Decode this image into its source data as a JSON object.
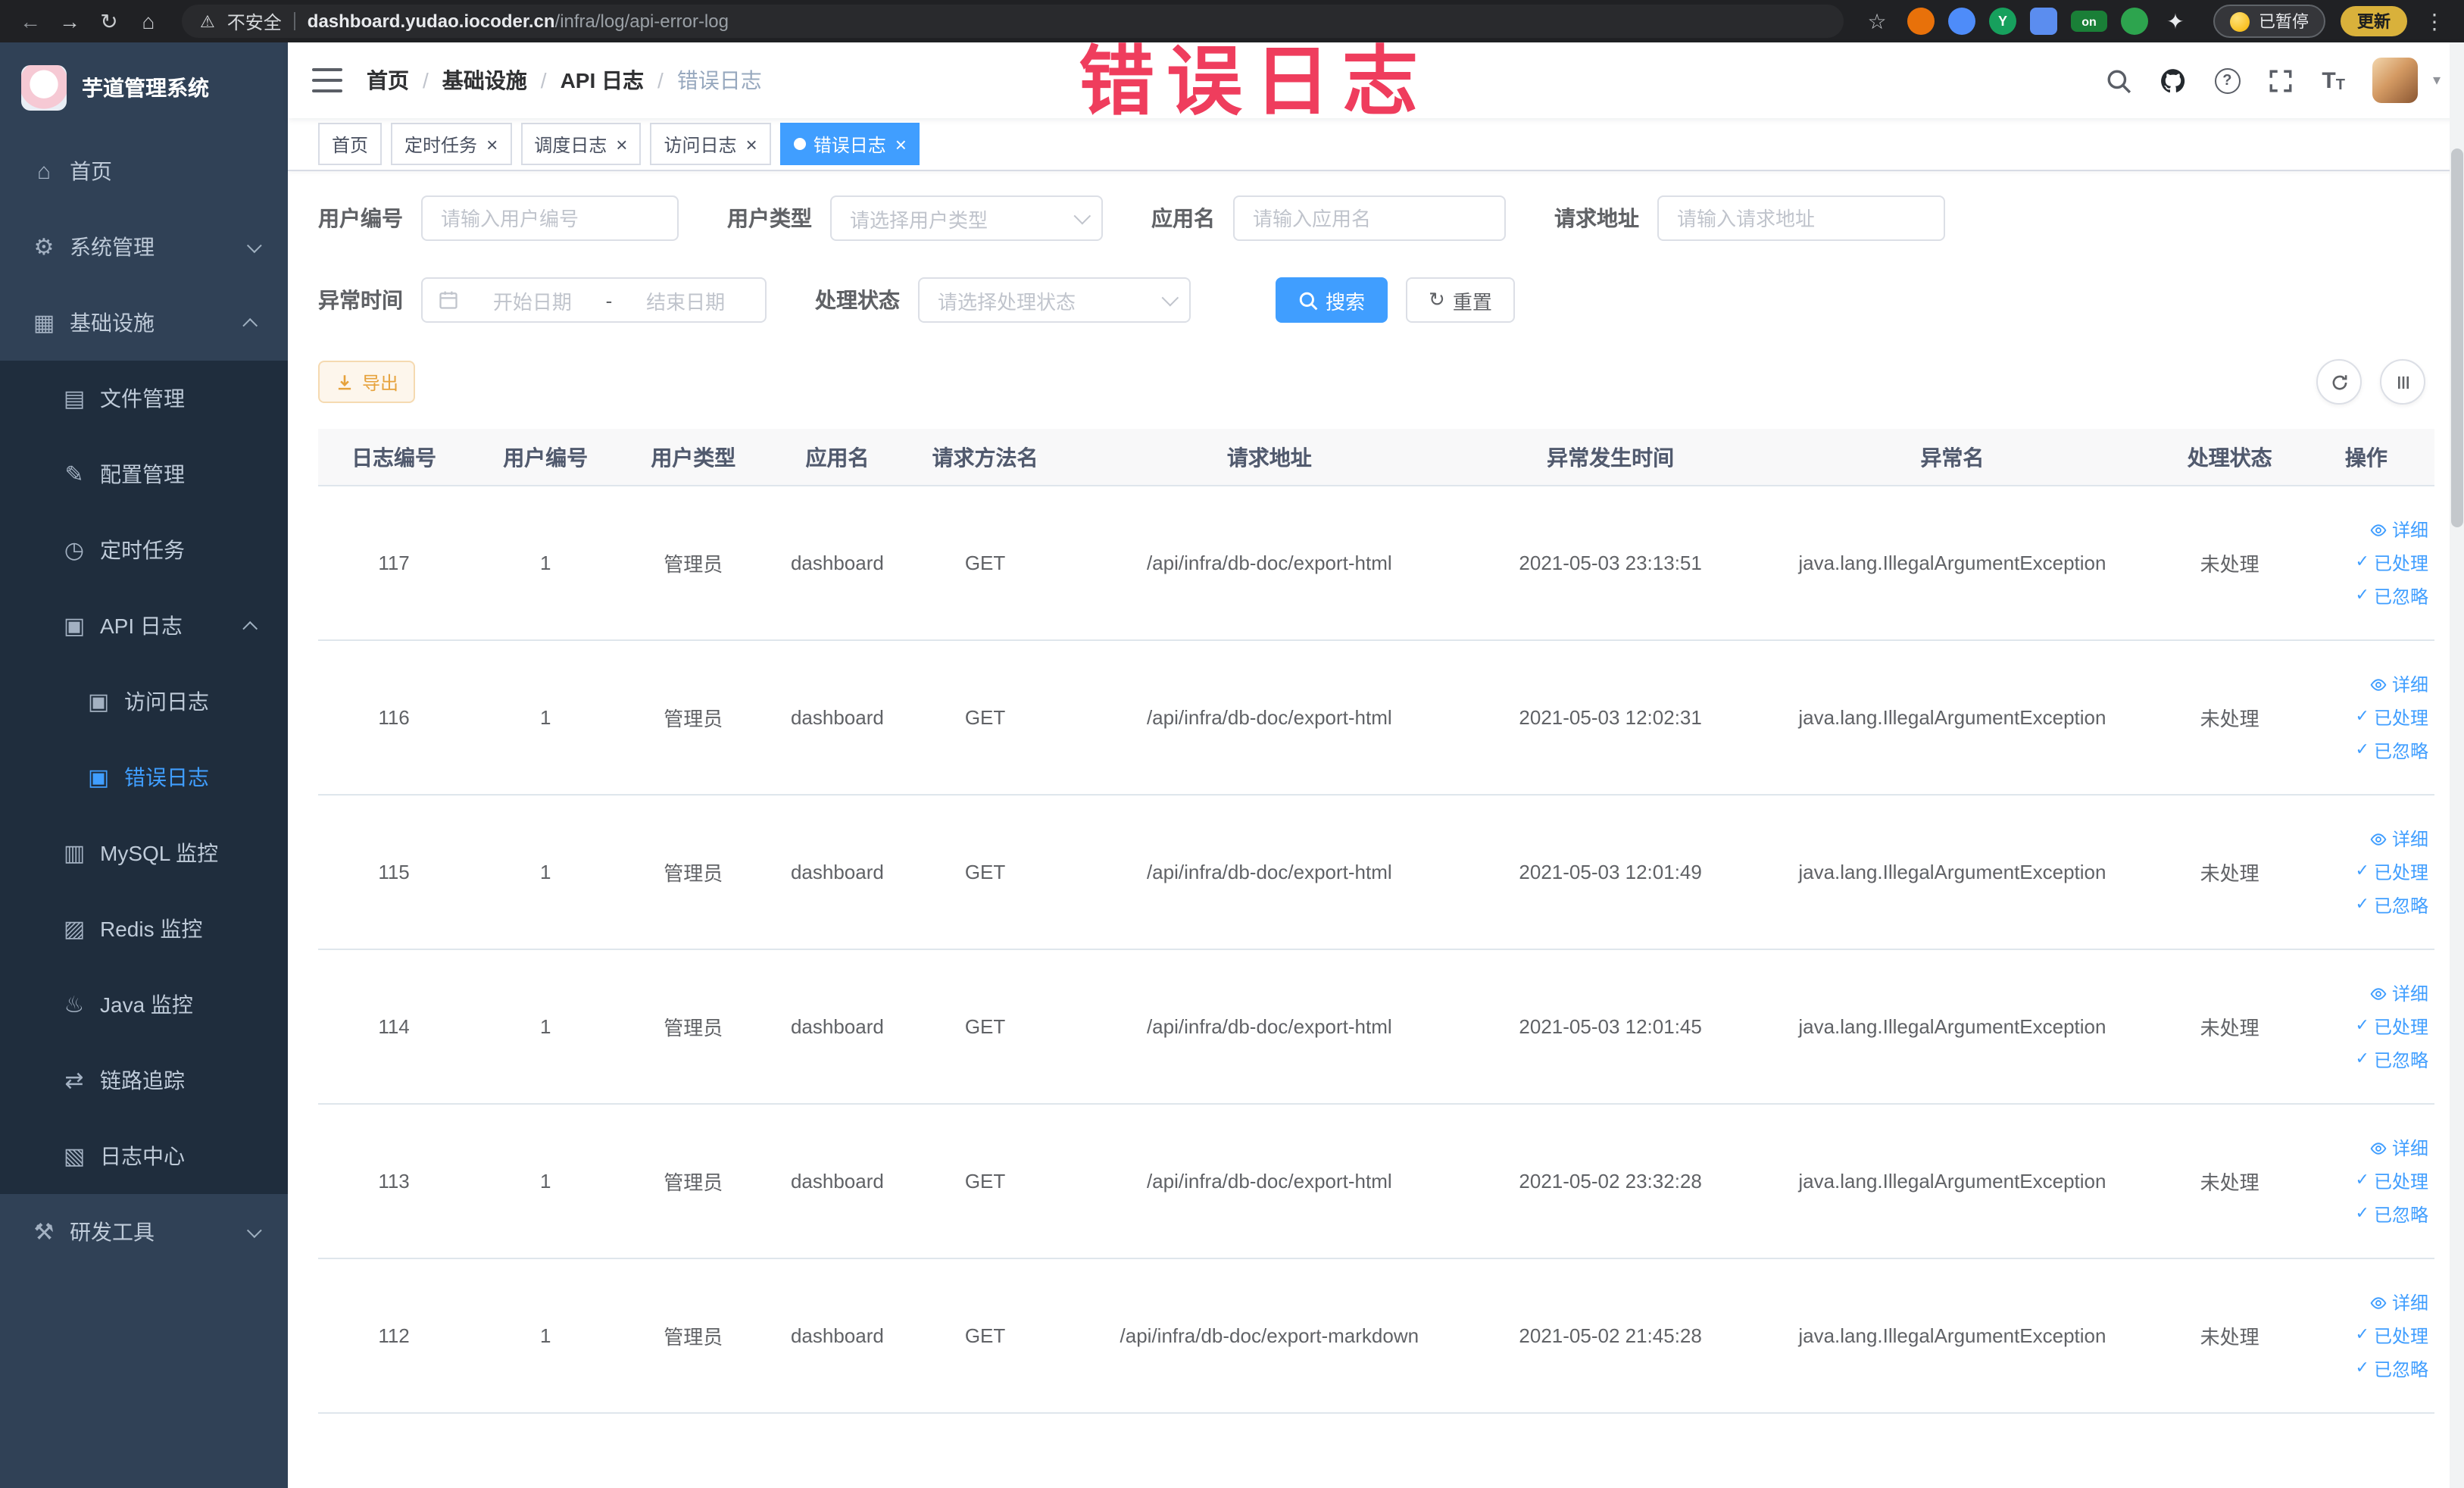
{
  "browser": {
    "security_label": "不安全",
    "url_host": "dashboard.yudao.iocoder.cn",
    "url_path": "/infra/log/api-error-log",
    "paused_badge": "已暂停",
    "update_button": "更新",
    "extensions": [
      {
        "name": "extension-orange-circle",
        "color": "#e8710a",
        "shape": "circle",
        "label": ""
      },
      {
        "name": "extension-blue-drop",
        "color": "#4e8cf9",
        "shape": "circle",
        "label": ""
      },
      {
        "name": "extension-green-y",
        "color": "#17a05d",
        "shape": "circle",
        "label": "Y"
      },
      {
        "name": "extension-blue-grid",
        "color": "#5b8def",
        "shape": "square",
        "label": ""
      },
      {
        "name": "extension-on-badge",
        "color": "#1a7f37",
        "shape": "pill",
        "label": "on"
      },
      {
        "name": "extension-green-leaf",
        "color": "#2da44e",
        "shape": "circle",
        "label": ""
      },
      {
        "name": "extension-pinwheel",
        "color": "#e8eaed",
        "shape": "star",
        "label": "✦"
      }
    ]
  },
  "icon_glyphs": {
    "back": "←",
    "forward": "→",
    "reload": "↻",
    "home_btn": "⌂",
    "star": "☆",
    "kebab": "⋮",
    "warning": "⚠",
    "close": "×",
    "check": "✓",
    "caret": "▾",
    "reset": "↻",
    "home": "⌂",
    "gear": "⚙",
    "grid": "▦",
    "folder": "▤",
    "edit": "✎",
    "clock": "◷",
    "doc": "▣",
    "mysql": "▥",
    "redis": "▨",
    "java": "♨",
    "link": "⇄",
    "file": "▧",
    "tool": "⚒"
  },
  "watermark": "错误日志",
  "sidebar": {
    "title": "芋道管理系统",
    "items": [
      {
        "label": "首页",
        "icon": "home",
        "depth": 0
      },
      {
        "label": "系统管理",
        "icon": "gear",
        "depth": 0,
        "chevron": "down"
      },
      {
        "label": "基础设施",
        "icon": "grid",
        "depth": 0,
        "chevron": "up"
      },
      {
        "label": "文件管理",
        "icon": "folder",
        "depth": 1
      },
      {
        "label": "配置管理",
        "icon": "edit",
        "depth": 1
      },
      {
        "label": "定时任务",
        "icon": "clock",
        "depth": 1
      },
      {
        "label": "API 日志",
        "icon": "doc",
        "depth": 1,
        "chevron": "up"
      },
      {
        "label": "访问日志",
        "icon": "doc",
        "depth": 2
      },
      {
        "label": "错误日志",
        "icon": "doc",
        "depth": 2,
        "active": true
      },
      {
        "label": "MySQL 监控",
        "icon": "mysql",
        "depth": 1
      },
      {
        "label": "Redis 监控",
        "icon": "redis",
        "depth": 1
      },
      {
        "label": "Java 监控",
        "icon": "java",
        "depth": 1
      },
      {
        "label": "链路追踪",
        "icon": "link",
        "depth": 1
      },
      {
        "label": "日志中心",
        "icon": "file",
        "depth": 1
      },
      {
        "label": "研发工具",
        "icon": "tool",
        "depth": 0,
        "chevron": "down"
      }
    ]
  },
  "header": {
    "breadcrumb": [
      "首页",
      "基础设施",
      "API 日志",
      "错误日志"
    ],
    "separator": "/"
  },
  "tabs": [
    {
      "label": "首页",
      "closable": false,
      "active": false
    },
    {
      "label": "定时任务",
      "closable": true,
      "active": false
    },
    {
      "label": "调度日志",
      "closable": true,
      "active": false
    },
    {
      "label": "访问日志",
      "closable": true,
      "active": false
    },
    {
      "label": "错误日志",
      "closable": true,
      "active": true
    }
  ],
  "filters": {
    "user_id": {
      "label": "用户编号",
      "placeholder": "请输入用户编号"
    },
    "user_type": {
      "label": "用户类型",
      "placeholder": "请选择用户类型"
    },
    "app_name": {
      "label": "应用名",
      "placeholder": "请输入应用名"
    },
    "request_url": {
      "label": "请求地址",
      "placeholder": "请输入请求地址"
    },
    "exception_time": {
      "label": "异常时间",
      "start_placeholder": "开始日期",
      "separator": "-",
      "end_placeholder": "结束日期"
    },
    "process_status": {
      "label": "处理状态",
      "placeholder": "请选择处理状态"
    },
    "search_button": "搜索",
    "reset_button": "重置"
  },
  "toolbar": {
    "export_button": "导出"
  },
  "table": {
    "columns": [
      "日志编号",
      "用户编号",
      "用户类型",
      "应用名",
      "请求方法名",
      "请求地址",
      "异常发生时间",
      "异常名",
      "处理状态",
      "操作"
    ],
    "actions": {
      "detail": "详细",
      "processed": "已处理",
      "ignored": "已忽略"
    },
    "rows": [
      {
        "id": "117",
        "user_id": "1",
        "user_type": "管理员",
        "app": "dashboard",
        "method": "GET",
        "url": "/api/infra/db-doc/export-html",
        "time": "2021-05-03 23:13:51",
        "exception": "java.lang.IllegalArgumentException",
        "status": "未处理"
      },
      {
        "id": "116",
        "user_id": "1",
        "user_type": "管理员",
        "app": "dashboard",
        "method": "GET",
        "url": "/api/infra/db-doc/export-html",
        "time": "2021-05-03 12:02:31",
        "exception": "java.lang.IllegalArgumentException",
        "status": "未处理"
      },
      {
        "id": "115",
        "user_id": "1",
        "user_type": "管理员",
        "app": "dashboard",
        "method": "GET",
        "url": "/api/infra/db-doc/export-html",
        "time": "2021-05-03 12:01:49",
        "exception": "java.lang.IllegalArgumentException",
        "status": "未处理"
      },
      {
        "id": "114",
        "user_id": "1",
        "user_type": "管理员",
        "app": "dashboard",
        "method": "GET",
        "url": "/api/infra/db-doc/export-html",
        "time": "2021-05-03 12:01:45",
        "exception": "java.lang.IllegalArgumentException",
        "status": "未处理"
      },
      {
        "id": "113",
        "user_id": "1",
        "user_type": "管理员",
        "app": "dashboard",
        "method": "GET",
        "url": "/api/infra/db-doc/export-html",
        "time": "2021-05-02 23:32:28",
        "exception": "java.lang.IllegalArgumentException",
        "status": "未处理"
      },
      {
        "id": "112",
        "user_id": "1",
        "user_type": "管理员",
        "app": "dashboard",
        "method": "GET",
        "url": "/api/infra/db-doc/export-markdown",
        "time": "2021-05-02 21:45:28",
        "exception": "java.lang.IllegalArgumentException",
        "status": "未处理"
      }
    ]
  }
}
